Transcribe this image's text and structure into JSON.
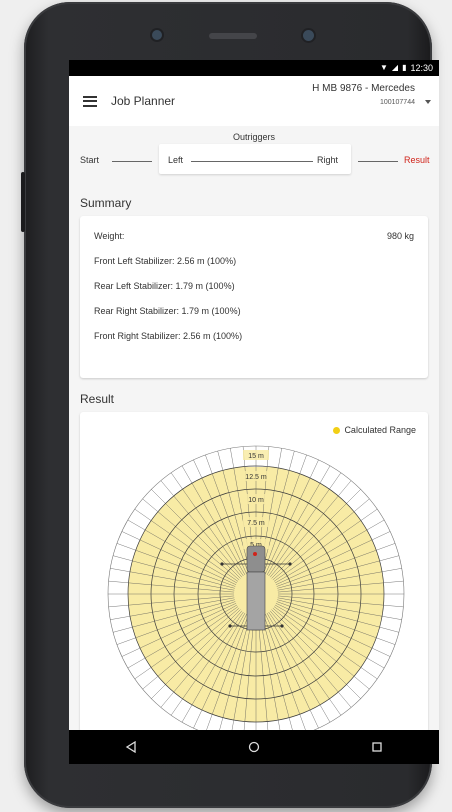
{
  "status_bar": {
    "time": "12:30"
  },
  "app_bar": {
    "title": "Job Planner",
    "vehicle_name": "H MB 9876 - Mercedes",
    "vehicle_id": "100107744"
  },
  "stepper": {
    "current_label": "Outriggers",
    "steps": {
      "start": "Start",
      "left": "Left",
      "right": "Right",
      "result": "Result"
    }
  },
  "summary": {
    "title": "Summary",
    "rows": [
      {
        "label": "Weight:",
        "value": "980 kg"
      },
      {
        "label": "Front Left Stabilizer: 2.56 m (100%)",
        "value": ""
      },
      {
        "label": "Rear Left Stabilizer: 1.79 m (100%)",
        "value": ""
      },
      {
        "label": "Rear Right Stabilizer: 1.79 m (100%)",
        "value": ""
      },
      {
        "label": "Front Right Stabilizer: 2.56 m (100%)",
        "value": ""
      }
    ]
  },
  "result": {
    "title": "Result",
    "legend": "Calculated Range",
    "colors": {
      "range_fill": "#f8eba5",
      "legend_dot": "#f2cf15",
      "grid": "#3a3a3a"
    },
    "rings": [
      "15 m",
      "12.5 m",
      "10 m",
      "7.5 m",
      "5 m"
    ]
  },
  "colors": {
    "accent_result": "#d0241b"
  },
  "nav": {
    "back": "back-icon",
    "home": "home-icon",
    "recents": "recents-icon"
  }
}
